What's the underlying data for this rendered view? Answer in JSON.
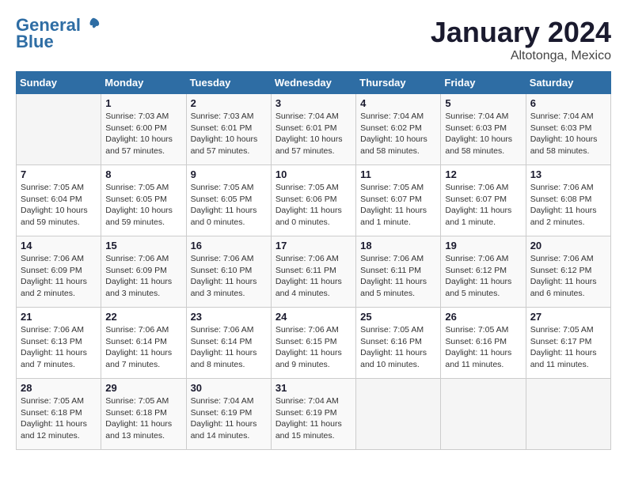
{
  "header": {
    "logo_line1": "General",
    "logo_line2": "Blue",
    "month": "January 2024",
    "location": "Altotonga, Mexico"
  },
  "days_of_week": [
    "Sunday",
    "Monday",
    "Tuesday",
    "Wednesday",
    "Thursday",
    "Friday",
    "Saturday"
  ],
  "weeks": [
    [
      {
        "day": "",
        "info": ""
      },
      {
        "day": "1",
        "info": "Sunrise: 7:03 AM\nSunset: 6:00 PM\nDaylight: 10 hours\nand 57 minutes."
      },
      {
        "day": "2",
        "info": "Sunrise: 7:03 AM\nSunset: 6:01 PM\nDaylight: 10 hours\nand 57 minutes."
      },
      {
        "day": "3",
        "info": "Sunrise: 7:04 AM\nSunset: 6:01 PM\nDaylight: 10 hours\nand 57 minutes."
      },
      {
        "day": "4",
        "info": "Sunrise: 7:04 AM\nSunset: 6:02 PM\nDaylight: 10 hours\nand 58 minutes."
      },
      {
        "day": "5",
        "info": "Sunrise: 7:04 AM\nSunset: 6:03 PM\nDaylight: 10 hours\nand 58 minutes."
      },
      {
        "day": "6",
        "info": "Sunrise: 7:04 AM\nSunset: 6:03 PM\nDaylight: 10 hours\nand 58 minutes."
      }
    ],
    [
      {
        "day": "7",
        "info": "Sunrise: 7:05 AM\nSunset: 6:04 PM\nDaylight: 10 hours\nand 59 minutes."
      },
      {
        "day": "8",
        "info": "Sunrise: 7:05 AM\nSunset: 6:05 PM\nDaylight: 10 hours\nand 59 minutes."
      },
      {
        "day": "9",
        "info": "Sunrise: 7:05 AM\nSunset: 6:05 PM\nDaylight: 11 hours\nand 0 minutes."
      },
      {
        "day": "10",
        "info": "Sunrise: 7:05 AM\nSunset: 6:06 PM\nDaylight: 11 hours\nand 0 minutes."
      },
      {
        "day": "11",
        "info": "Sunrise: 7:05 AM\nSunset: 6:07 PM\nDaylight: 11 hours\nand 1 minute."
      },
      {
        "day": "12",
        "info": "Sunrise: 7:06 AM\nSunset: 6:07 PM\nDaylight: 11 hours\nand 1 minute."
      },
      {
        "day": "13",
        "info": "Sunrise: 7:06 AM\nSunset: 6:08 PM\nDaylight: 11 hours\nand 2 minutes."
      }
    ],
    [
      {
        "day": "14",
        "info": "Sunrise: 7:06 AM\nSunset: 6:09 PM\nDaylight: 11 hours\nand 2 minutes."
      },
      {
        "day": "15",
        "info": "Sunrise: 7:06 AM\nSunset: 6:09 PM\nDaylight: 11 hours\nand 3 minutes."
      },
      {
        "day": "16",
        "info": "Sunrise: 7:06 AM\nSunset: 6:10 PM\nDaylight: 11 hours\nand 3 minutes."
      },
      {
        "day": "17",
        "info": "Sunrise: 7:06 AM\nSunset: 6:11 PM\nDaylight: 11 hours\nand 4 minutes."
      },
      {
        "day": "18",
        "info": "Sunrise: 7:06 AM\nSunset: 6:11 PM\nDaylight: 11 hours\nand 5 minutes."
      },
      {
        "day": "19",
        "info": "Sunrise: 7:06 AM\nSunset: 6:12 PM\nDaylight: 11 hours\nand 5 minutes."
      },
      {
        "day": "20",
        "info": "Sunrise: 7:06 AM\nSunset: 6:12 PM\nDaylight: 11 hours\nand 6 minutes."
      }
    ],
    [
      {
        "day": "21",
        "info": "Sunrise: 7:06 AM\nSunset: 6:13 PM\nDaylight: 11 hours\nand 7 minutes."
      },
      {
        "day": "22",
        "info": "Sunrise: 7:06 AM\nSunset: 6:14 PM\nDaylight: 11 hours\nand 7 minutes."
      },
      {
        "day": "23",
        "info": "Sunrise: 7:06 AM\nSunset: 6:14 PM\nDaylight: 11 hours\nand 8 minutes."
      },
      {
        "day": "24",
        "info": "Sunrise: 7:06 AM\nSunset: 6:15 PM\nDaylight: 11 hours\nand 9 minutes."
      },
      {
        "day": "25",
        "info": "Sunrise: 7:05 AM\nSunset: 6:16 PM\nDaylight: 11 hours\nand 10 minutes."
      },
      {
        "day": "26",
        "info": "Sunrise: 7:05 AM\nSunset: 6:16 PM\nDaylight: 11 hours\nand 11 minutes."
      },
      {
        "day": "27",
        "info": "Sunrise: 7:05 AM\nSunset: 6:17 PM\nDaylight: 11 hours\nand 11 minutes."
      }
    ],
    [
      {
        "day": "28",
        "info": "Sunrise: 7:05 AM\nSunset: 6:18 PM\nDaylight: 11 hours\nand 12 minutes."
      },
      {
        "day": "29",
        "info": "Sunrise: 7:05 AM\nSunset: 6:18 PM\nDaylight: 11 hours\nand 13 minutes."
      },
      {
        "day": "30",
        "info": "Sunrise: 7:04 AM\nSunset: 6:19 PM\nDaylight: 11 hours\nand 14 minutes."
      },
      {
        "day": "31",
        "info": "Sunrise: 7:04 AM\nSunset: 6:19 PM\nDaylight: 11 hours\nand 15 minutes."
      },
      {
        "day": "",
        "info": ""
      },
      {
        "day": "",
        "info": ""
      },
      {
        "day": "",
        "info": ""
      }
    ]
  ]
}
